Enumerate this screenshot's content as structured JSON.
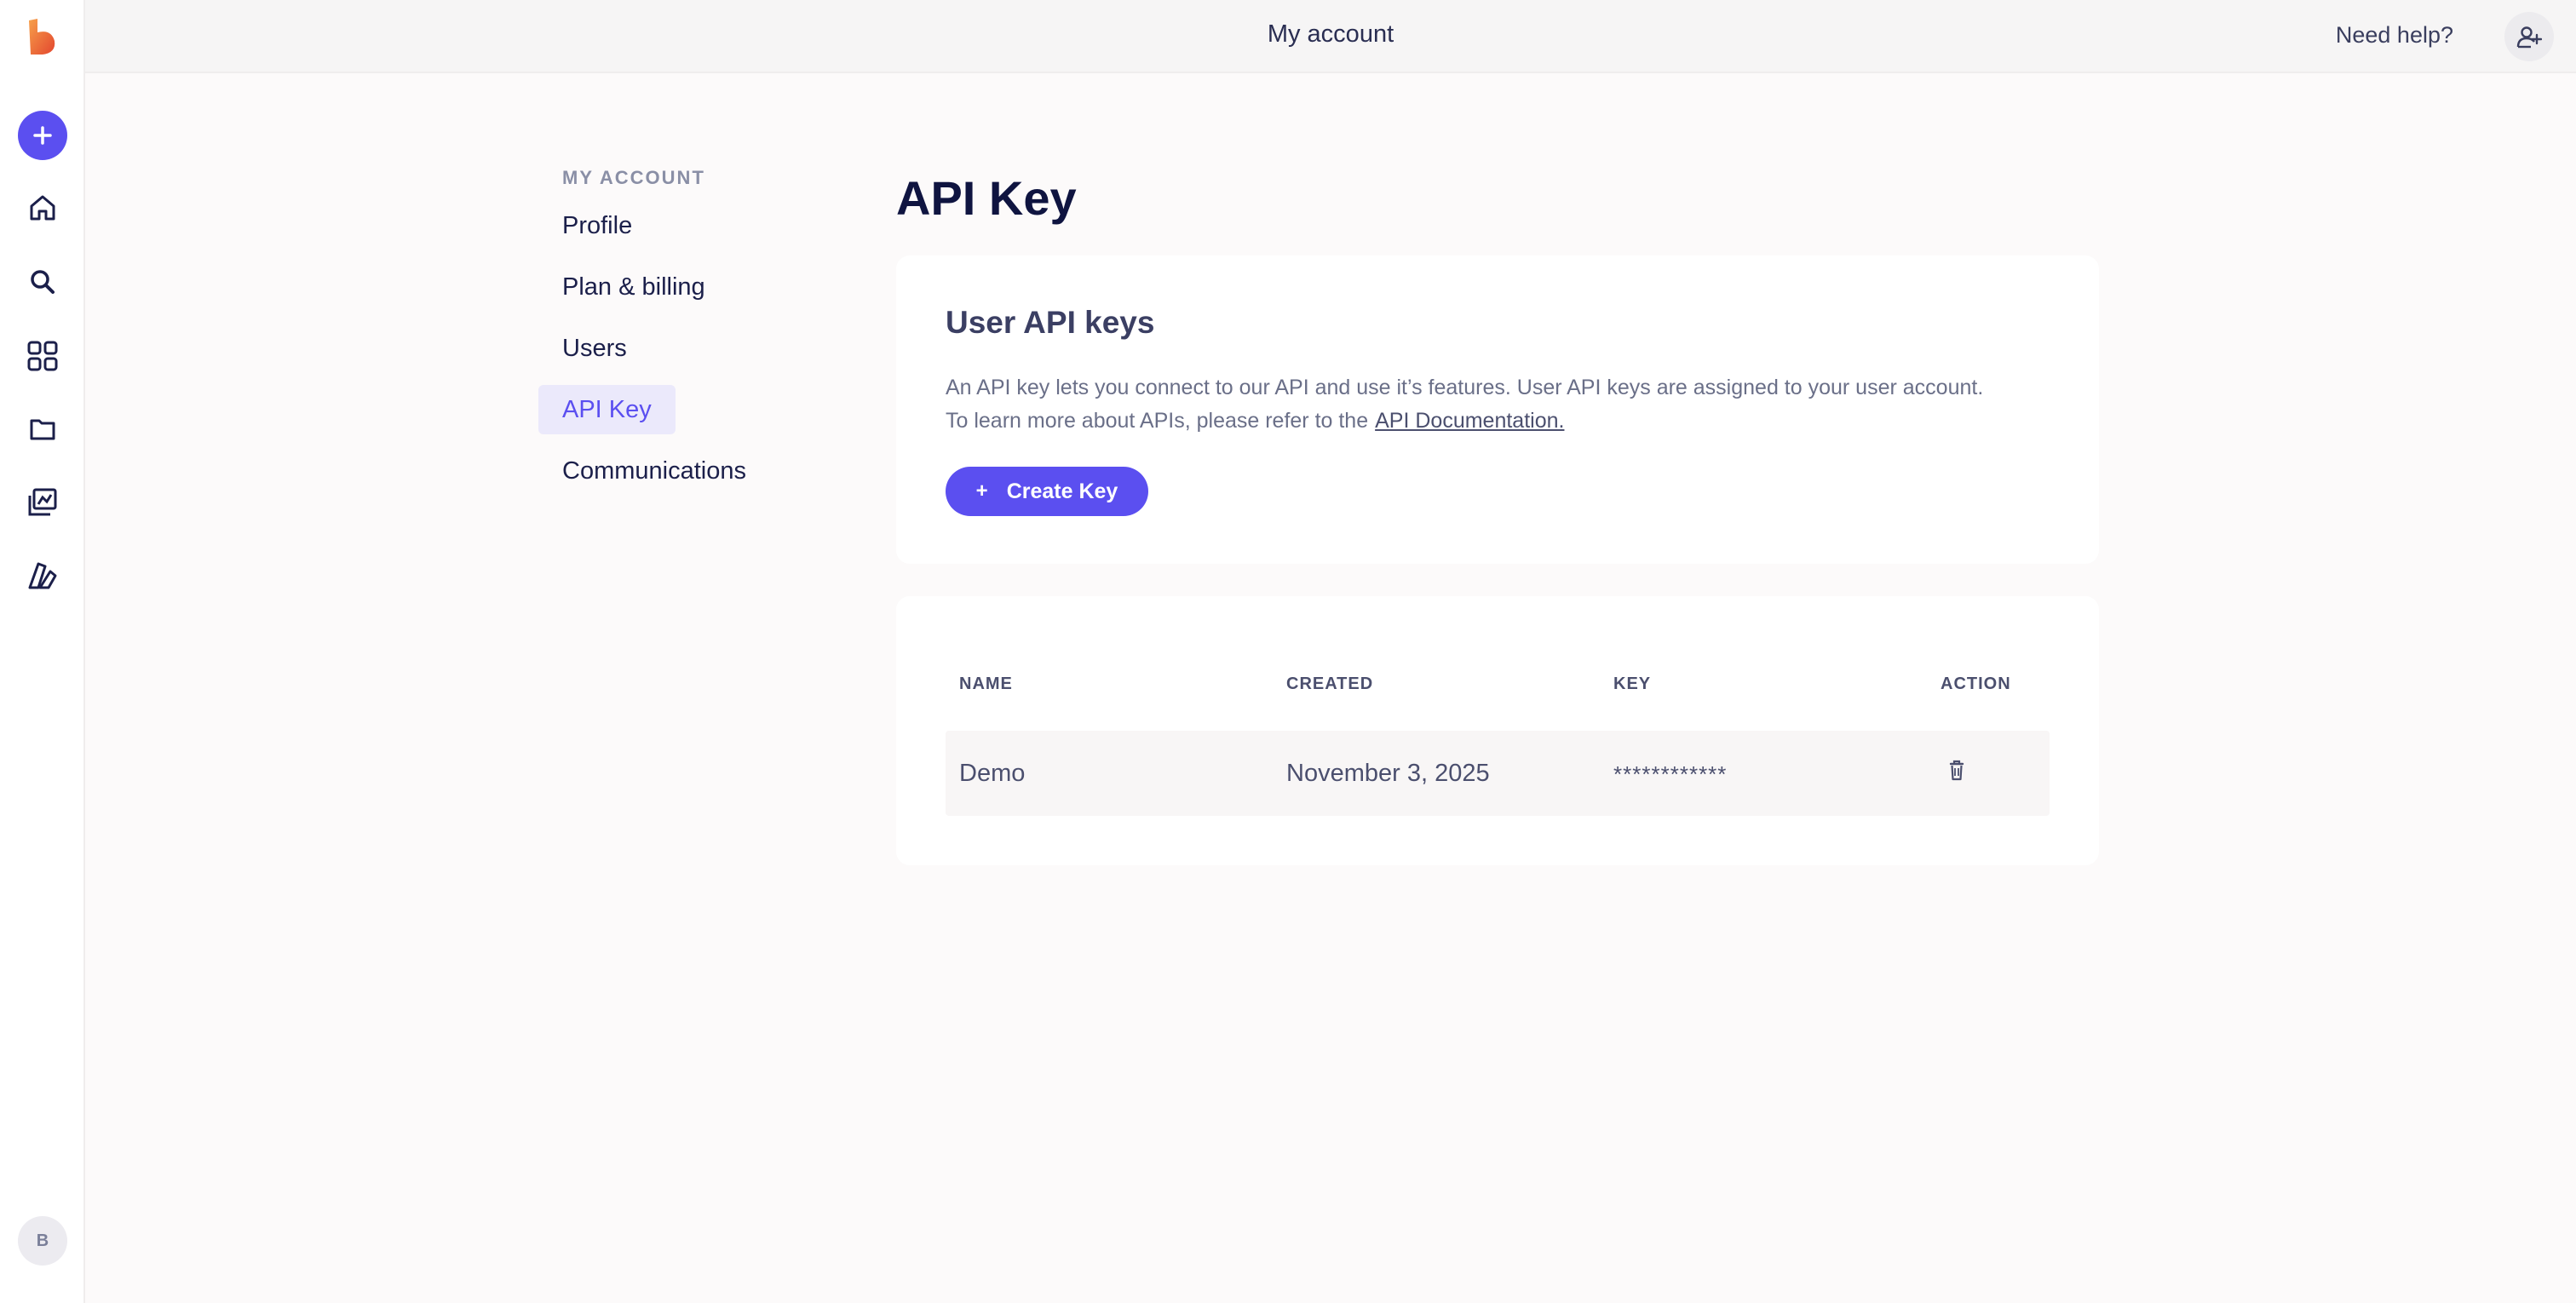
{
  "app": {
    "title": "My account",
    "help_label": "Need help?",
    "avatar_initial": "B",
    "accent_color": "#5b4ff0"
  },
  "rail": {
    "icons": [
      "plus-icon",
      "home-icon",
      "search-icon",
      "grid-icon",
      "folder-icon",
      "gallery-icon",
      "design-icon"
    ]
  },
  "account_nav": {
    "heading": "MY ACCOUNT",
    "items": [
      {
        "label": "Profile"
      },
      {
        "label": "Plan & billing"
      },
      {
        "label": "Users"
      },
      {
        "label": "API Key",
        "active": true
      },
      {
        "label": "Communications"
      }
    ]
  },
  "main": {
    "title": "API Key",
    "card": {
      "title": "User API keys",
      "desc_line1": "An API key lets you connect to our API and use it’s features. User API keys are assigned to your user account.",
      "desc_line2": "To learn more about APIs, please refer to the",
      "link_label": "API Documentation.",
      "create_plus": "+",
      "create_label": "Create Key"
    },
    "table": {
      "headers": [
        "NAME",
        "CREATED",
        "KEY",
        "ACTION"
      ],
      "rows": [
        {
          "name": "Demo",
          "created": "November 3, 2025",
          "key": "************",
          "action": "trash-icon"
        }
      ]
    }
  }
}
